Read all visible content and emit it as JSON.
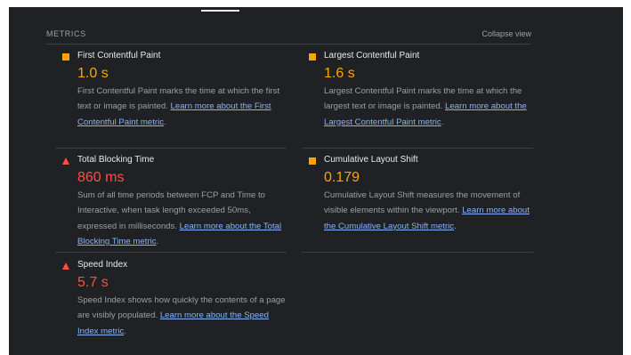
{
  "header": {
    "title": "METRICS",
    "collapse_label": "Collapse view"
  },
  "metrics": [
    {
      "label": "First Contentful Paint",
      "value": "1.0 s",
      "status": "average",
      "icon": "orange-square-icon",
      "desc": "First Contentful Paint marks the time at which the first text or image is painted.",
      "link": "Learn more about the First Contentful Paint metric"
    },
    {
      "label": "Largest Contentful Paint",
      "value": "1.6 s",
      "status": "average",
      "icon": "orange-square-icon",
      "desc": "Largest Contentful Paint marks the time at which the largest text or image is painted.",
      "link": "Learn more about the Largest Contentful Paint metric"
    },
    {
      "label": "Total Blocking Time",
      "value": "860 ms",
      "status": "fail",
      "icon": "red-triangle-icon",
      "desc": "Sum of all time periods between FCP and Time to Interactive, when task length exceeded 50ms, expressed in milliseconds.",
      "link": "Learn more about the Total Blocking Time metric"
    },
    {
      "label": "Cumulative Layout Shift",
      "value": "0.179",
      "status": "average",
      "icon": "orange-square-icon",
      "desc": "Cumulative Layout Shift measures the movement of visible elements within the viewport.",
      "link": "Learn more about the Cumulative Layout Shift metric"
    },
    {
      "label": "Speed Index",
      "value": "5.7 s",
      "status": "fail",
      "icon": "red-triangle-icon",
      "desc": "Speed Index shows how quickly the contents of a page are visibly populated.",
      "link": "Learn more about the Speed Index metric"
    }
  ],
  "colors": {
    "background": "#202124",
    "average": "#ffa400",
    "fail": "#ff4e42",
    "link": "#8ab4f8"
  }
}
